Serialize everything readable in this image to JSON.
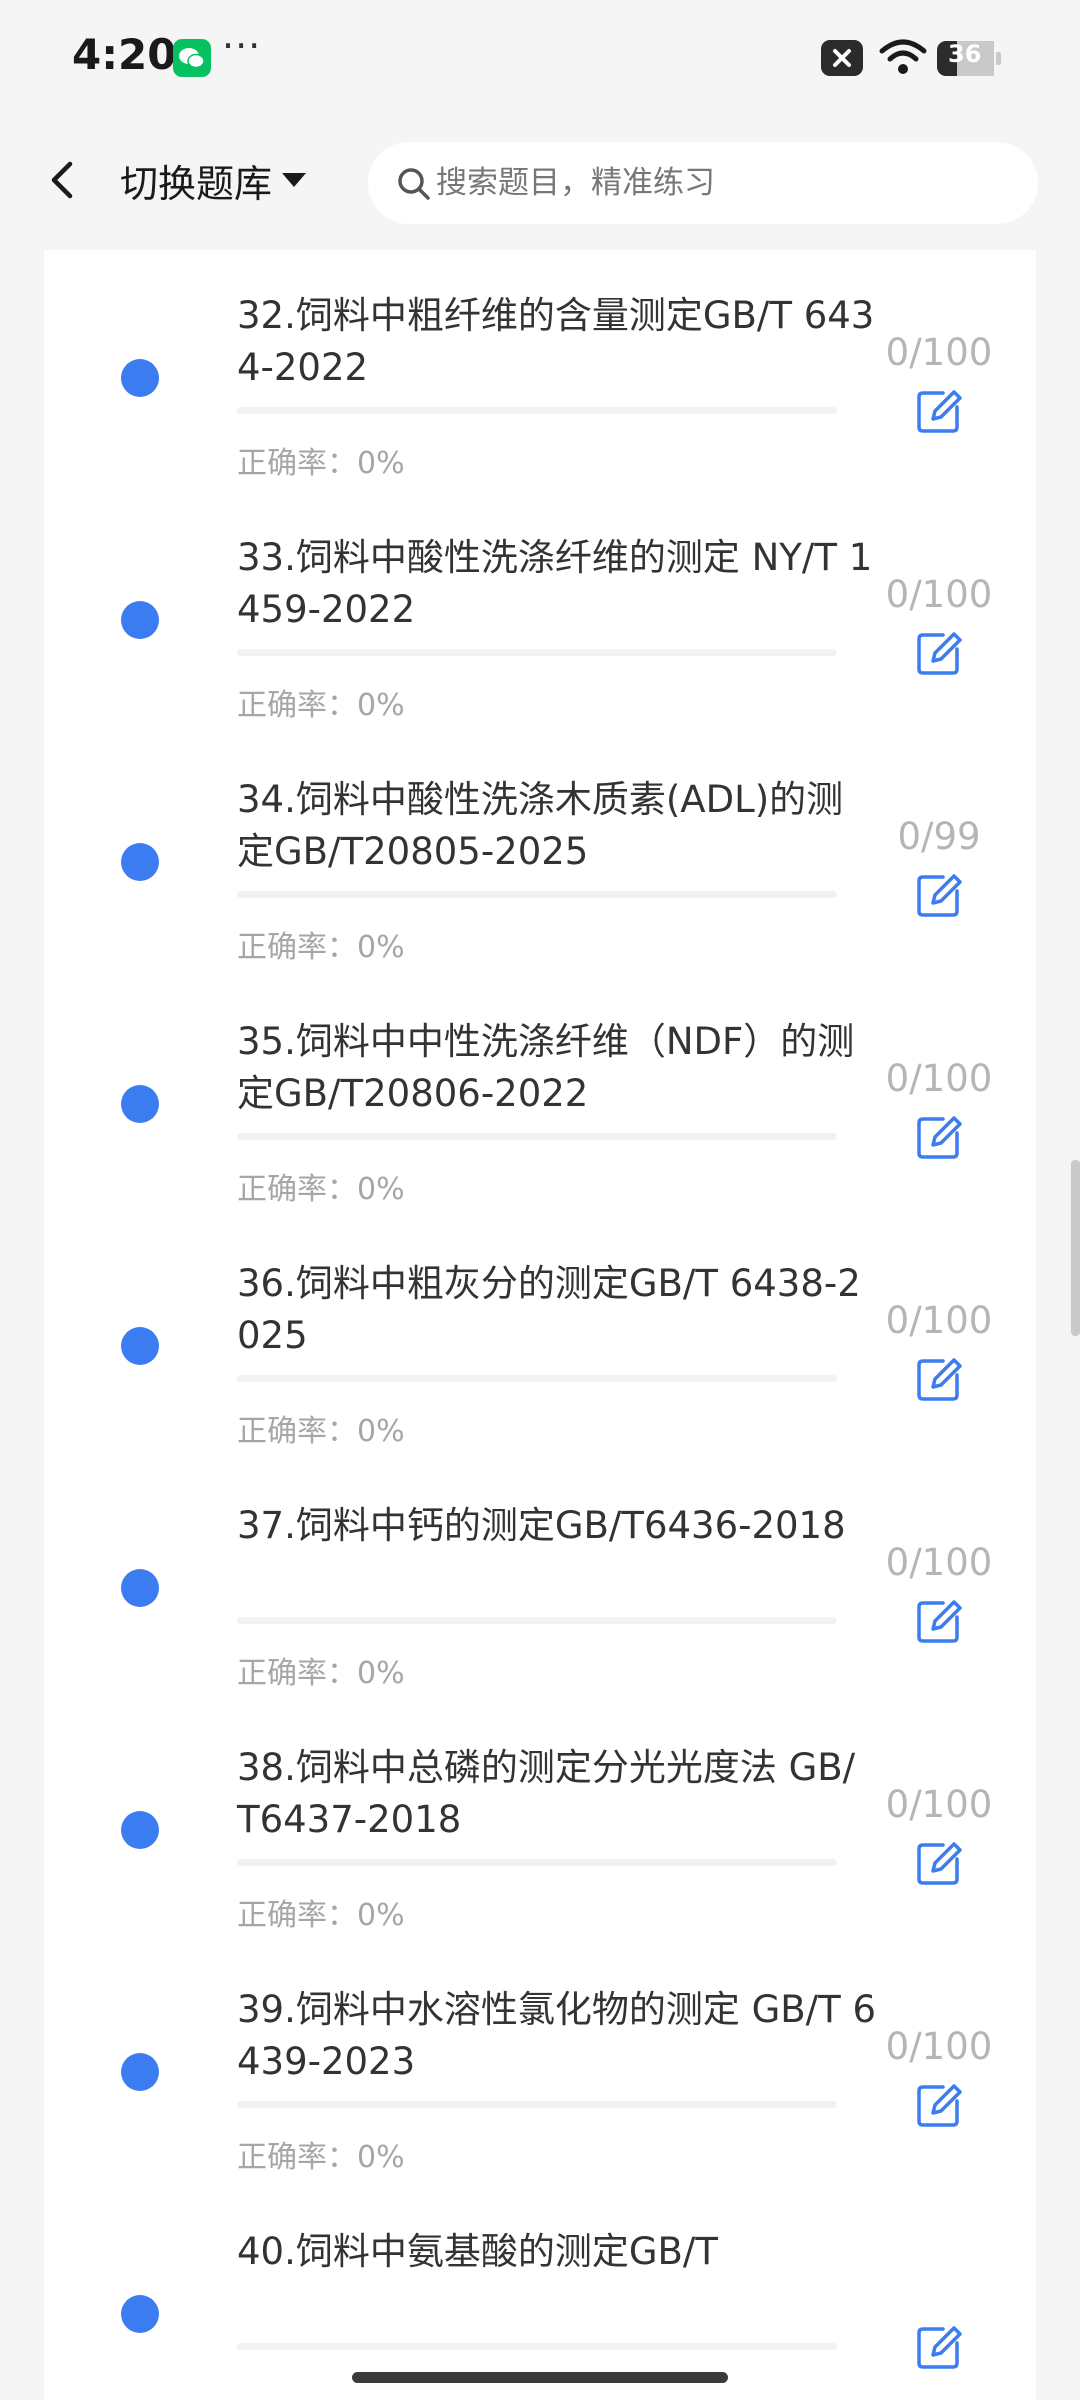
{
  "status_bar": {
    "time": "4:20",
    "more": "···",
    "battery": "36",
    "icons": [
      "wechat-icon",
      "x-box-icon",
      "wifi-icon",
      "battery-icon"
    ]
  },
  "header": {
    "back_icon": "back-arrow-icon",
    "bank_switch_label": "切换题库",
    "search_placeholder": "搜索题目，精准练习"
  },
  "colors": {
    "accent": "#3b7cf1",
    "muted_text": "#a6a6a6",
    "progress_text": "#b5b5b5",
    "background": "#f5f5f5"
  },
  "chapters": [
    {
      "title": "",
      "progress": "",
      "accuracy": "正确率：0%"
    },
    {
      "title": "32.饲料中粗纤维的含量测定GB/T 6434-2022",
      "progress": "0/100",
      "accuracy": "正确率：0%"
    },
    {
      "title": "33.饲料中酸性洗涤纤维的测定 NY/T 1459-2022",
      "progress": "0/100",
      "accuracy": "正确率：0%"
    },
    {
      "title": "34.饲料中酸性洗涤木质素(ADL)的测 定GB/T20805-2025",
      "progress": "0/99",
      "accuracy": "正确率：0%"
    },
    {
      "title": "35.饲料中中性洗涤纤维（NDF）的测 定GB/T20806-2022",
      "progress": "0/100",
      "accuracy": "正确率：0%"
    },
    {
      "title": "36.饲料中粗灰分的测定GB/T 6438-2025",
      "progress": "0/100",
      "accuracy": "正确率：0%"
    },
    {
      "title": "37.饲料中钙的测定GB/T6436-2018",
      "progress": "0/100",
      "accuracy": "正确率：0%"
    },
    {
      "title": "38.饲料中总磷的测定分光光度法 GB/T6437-2018",
      "progress": "0/100",
      "accuracy": "正确率：0%"
    },
    {
      "title": "39.饲料中水溶性氯化物的测定 GB/T 6439-2023",
      "progress": "0/100",
      "accuracy": "正确率：0%"
    },
    {
      "title": "40.饲料中氨基酸的测定GB/T",
      "progress": "",
      "accuracy": ""
    }
  ]
}
